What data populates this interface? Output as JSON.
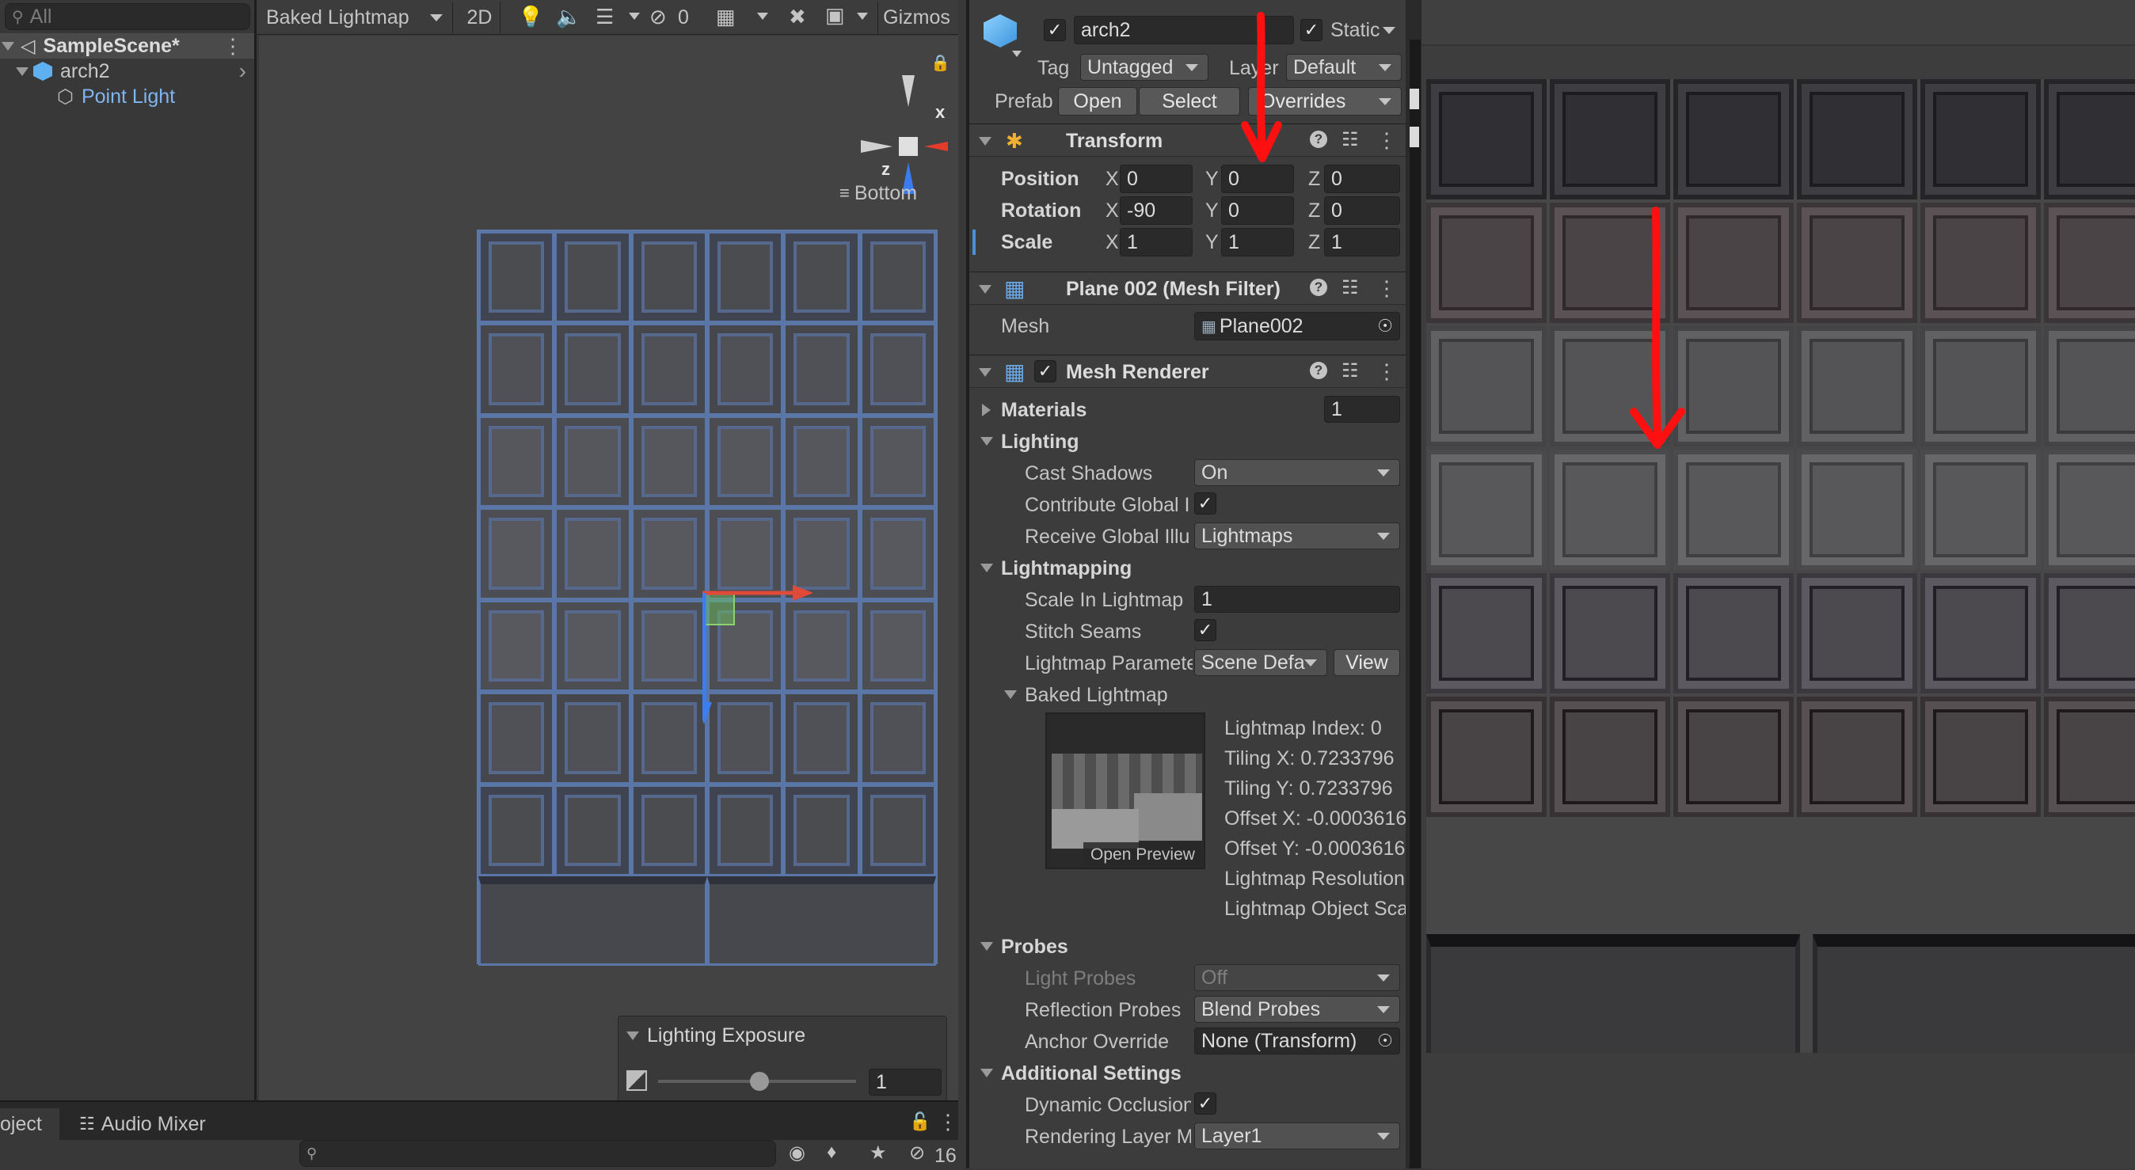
{
  "hierarchy": {
    "search_placeholder": "All",
    "scene": "SampleScene*",
    "items": [
      {
        "label": "arch2"
      },
      {
        "label": "Point Light"
      }
    ]
  },
  "scene_toolbar": {
    "draw_mode": "Baked Lightmap",
    "mode_2d": "2D",
    "hidden_count": "0",
    "gizmos": "Gizmos"
  },
  "gizmo": {
    "x": "x",
    "z": "z",
    "view": "Bottom"
  },
  "exposure": {
    "title": "Lighting Exposure",
    "value": "1"
  },
  "bottom_bar": {
    "tabs": [
      "oject",
      "Audio Mixer"
    ],
    "hidden_count": "16"
  },
  "inspector": {
    "object_name": "arch2",
    "static": "Static",
    "tag_label": "Tag",
    "tag_value": "Untagged",
    "layer_label": "Layer",
    "layer_value": "Default",
    "prefab_label": "Prefab",
    "prefab_open": "Open",
    "prefab_select": "Select",
    "prefab_overrides": "Overrides",
    "transform": {
      "title": "Transform",
      "rows": [
        {
          "label": "Position",
          "x": "0",
          "y": "0",
          "z": "0"
        },
        {
          "label": "Rotation",
          "x": "-90",
          "y": "0",
          "z": "0"
        },
        {
          "label": "Scale",
          "x": "1",
          "y": "1",
          "z": "1"
        }
      ],
      "axis_x": "X",
      "axis_y": "Y",
      "axis_z": "Z"
    },
    "mesh_filter": {
      "title": "Plane 002 (Mesh Filter)",
      "mesh_label": "Mesh",
      "mesh_value": "Plane002"
    },
    "mesh_renderer": {
      "title": "Mesh Renderer",
      "materials_label": "Materials",
      "materials_count": "1",
      "lighting": "Lighting",
      "cast_shadows_label": "Cast Shadows",
      "cast_shadows_value": "On",
      "contribute_gi_label": "Contribute Global I",
      "receive_gi_label": "Receive Global Illu",
      "receive_gi_value": "Lightmaps",
      "lightmapping": "Lightmapping",
      "scale_label": "Scale In Lightmap",
      "scale_value": "1",
      "stitch_label": "Stitch Seams",
      "params_label": "Lightmap Paramete",
      "params_value": "Scene Defa",
      "view_button": "View",
      "baked_lightmap": "Baked Lightmap",
      "open_preview": "Open Preview",
      "lightmap_info": [
        "Lightmap Index: 0",
        "Tiling X: 0.7233796",
        "Tiling Y: 0.7233796",
        "Offset X: -0.0003616",
        "Offset Y: -0.0003616",
        "Lightmap Resolution:",
        "Lightmap Object Sca"
      ],
      "probes": "Probes",
      "light_probes_label": "Light Probes",
      "light_probes_value": "Off",
      "reflection_label": "Reflection Probes",
      "reflection_value": "Blend Probes",
      "anchor_label": "Anchor Override",
      "anchor_value": "None (Transform)",
      "additional": "Additional Settings",
      "dynamic_occ_label": "Dynamic Occlusion",
      "rendering_layer_label": "Rendering Layer M",
      "rendering_layer_value": "Layer1"
    }
  },
  "colors": {
    "accent_blue": "#4b8fd6",
    "annotation_red": "#ff1010",
    "selection": "#2c5d87"
  }
}
